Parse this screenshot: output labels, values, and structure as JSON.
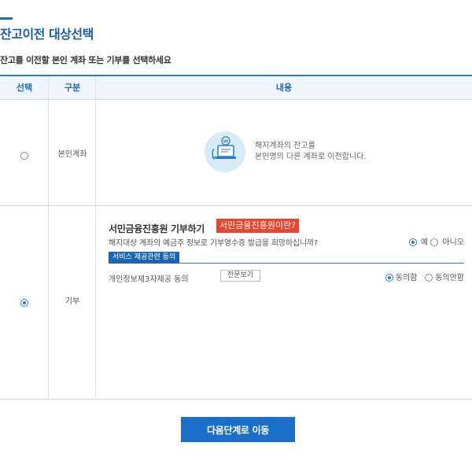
{
  "page": {
    "title": "잔고이전 대상선택",
    "subtitle": "잔고를 이전할 본인 계좌 또는 기부를 선택하세요"
  },
  "table": {
    "headers": [
      "선택",
      "구분",
      "내용"
    ],
    "rows": [
      {
        "label": "본인계좌",
        "selected": false,
        "info_line1": "해지계좌의 잔고를",
        "info_line2": "본인명의 다른 계좌로 이전합니다."
      },
      {
        "label": "기부",
        "selected": true,
        "donate_title": "서민금융진흥원 기부하기",
        "what_button": "서민금융진흥원이란?",
        "question": "해지대상 계좌의 예금주 정보로 기부영수증 발급을 희망하십니까?",
        "yes_label": "예",
        "no_label": "아니오",
        "yes_selected": true,
        "service_tag": "서비스 제공관련 동의",
        "consent_label": "개인정보제3자제공 동의",
        "fulltext_button": "전문보기",
        "agree_label": "동의함",
        "disagree_label": "동의안함",
        "agree_selected": true
      }
    ]
  },
  "next_button": "다음단계로 이동",
  "colors": {
    "accent": "#1a6fc8",
    "header_bg": "#eef5fc",
    "badge_red": "#e8462e"
  },
  "icons": {
    "transfer": "computer-transfer-icon"
  }
}
